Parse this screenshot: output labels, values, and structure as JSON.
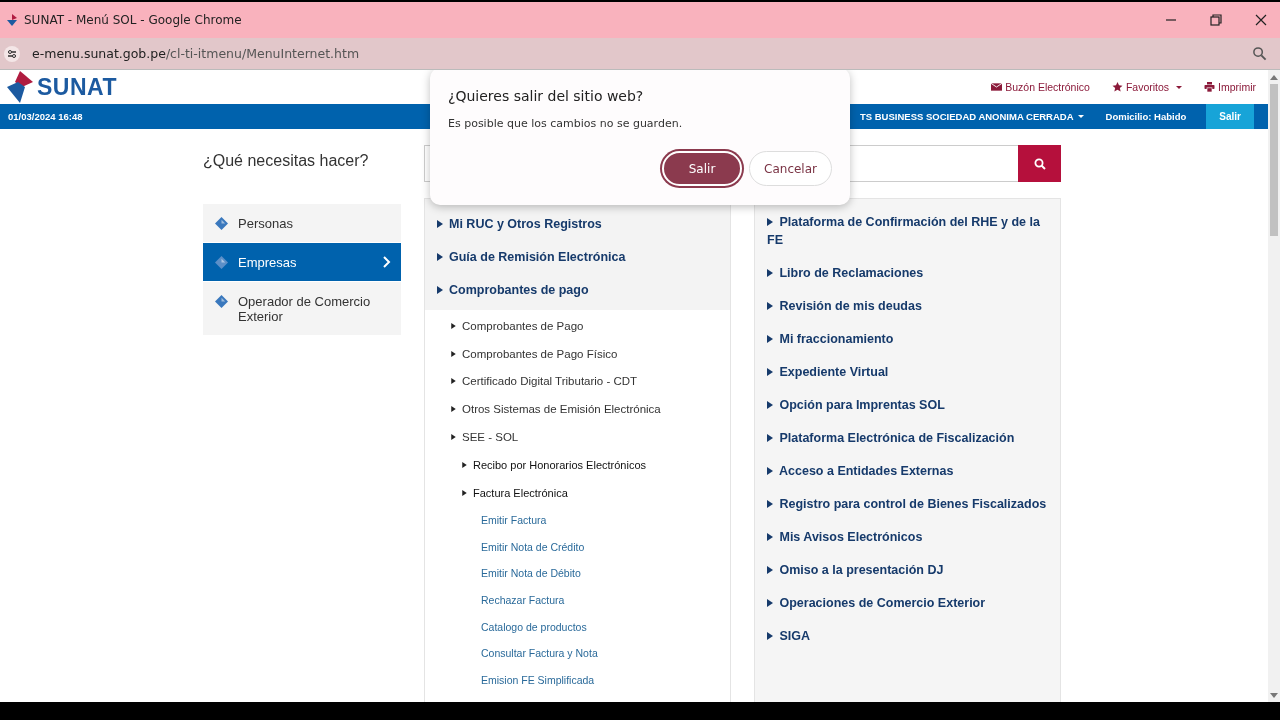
{
  "browser": {
    "title": "SUNAT - Menú SOL - Google Chrome",
    "url_host": "e-menu.sunat.gob.pe",
    "url_path": "/cl-ti-itmenu/MenuInternet.htm"
  },
  "header": {
    "logo": "SUNAT",
    "links": [
      {
        "kind": "mail",
        "label": "Buzón Electrónico"
      },
      {
        "kind": "star",
        "label": "Favoritos"
      },
      {
        "kind": "print",
        "label": "Imprimir"
      }
    ]
  },
  "user_bar": {
    "datetime": "01/03/2024 16:48",
    "company": "TS BUSINESS SOCIEDAD ANONIMA CERRADA",
    "domicilio": "Domicilio: Habido",
    "logout": "Salir"
  },
  "question": "¿Qué necesitas hacer?",
  "sidebar": {
    "items": [
      {
        "label": "Personas",
        "selected": false
      },
      {
        "label": "Empresas",
        "selected": true
      },
      {
        "label": "Operador de Comercio Exterior",
        "selected": false
      }
    ]
  },
  "menu_main": [
    {
      "label": "Mi RUC y Otros Registros"
    },
    {
      "label": "Guía de Remisión Electrónica"
    },
    {
      "label": "Comprobantes de pago",
      "children": [
        {
          "label": "Comprobantes de Pago"
        },
        {
          "label": "Comprobantes de Pago Físico"
        },
        {
          "label": "Certificado Digital Tributario - CDT"
        },
        {
          "label": "Otros Sistemas de Emisión Electrónica"
        },
        {
          "label": "SEE - SOL",
          "children": [
            {
              "label": "Recibo por Honorarios Electrónicos"
            },
            {
              "label": "Factura Electrónica",
              "children": [
                {
                  "label": "Emitir Factura"
                },
                {
                  "label": "Emitir Nota de Crédito"
                },
                {
                  "label": "Emitir Nota de Débito"
                },
                {
                  "label": "Rechazar Factura"
                },
                {
                  "label": "Catalogo de productos"
                },
                {
                  "label": "Consultar Factura y Nota"
                },
                {
                  "label": "Emision FE Simplificada"
                }
              ]
            }
          ]
        }
      ]
    }
  ],
  "menu_side": [
    "Plataforma de Confirmación del RHE y de la FE",
    "Libro de Reclamaciones",
    "Revisión de mis deudas",
    "Mi fraccionamiento",
    "Expediente Virtual",
    "Opción para Imprentas SOL",
    "Plataforma Electrónica de Fiscalización",
    "Acceso a Entidades Externas",
    "Registro para control de Bienes Fiscalizados",
    "Mis Avisos Electrónicos",
    "Omiso a la presentación DJ",
    "Operaciones de Comercio Exterior",
    "SIGA"
  ],
  "dialog": {
    "title": "¿Quieres salir del sitio web?",
    "message": "Es posible que los cambios no se guarden.",
    "buttons": [
      {
        "label": "Salir",
        "primary": true
      },
      {
        "label": "Cancelar",
        "primary": false
      }
    ]
  }
}
